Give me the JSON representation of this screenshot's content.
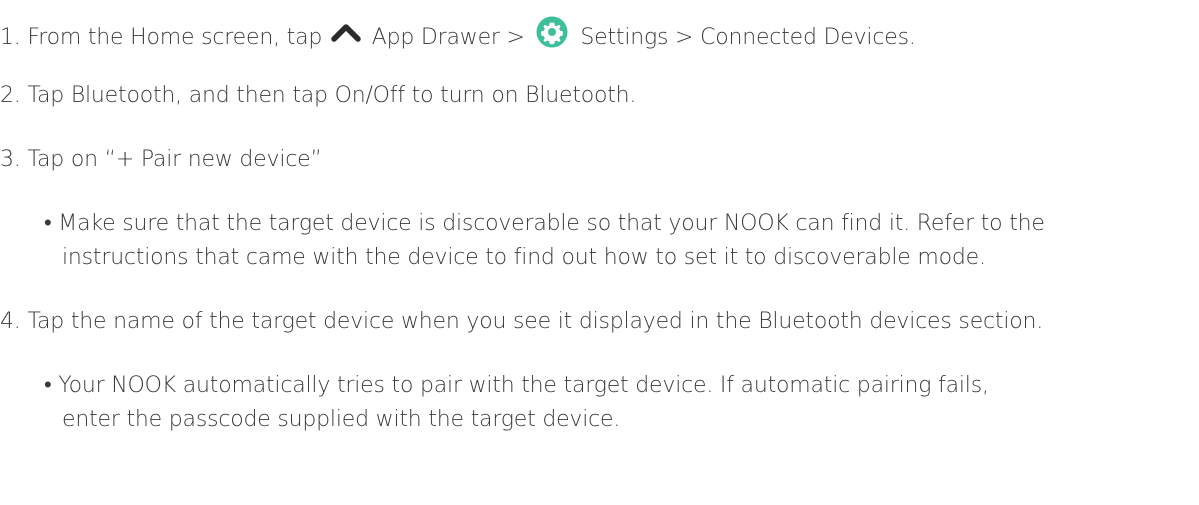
{
  "steps": {
    "step1": {
      "prefix": "1. From the Home screen, tap",
      "app_drawer": "App Drawer >",
      "settings": "Settings > Connected Devices.",
      "icons": [
        "chevron-up-icon",
        "gear-icon"
      ],
      "gear_color": "#3cbf9a"
    },
    "step2": "2. Tap Bluetooth, and then tap On/Off to turn on Bluetooth.",
    "step3": "3. Tap on “+ Pair new device”",
    "bullet1_line1": "• Make sure that the target device is discoverable so that your NOOK can find it. Refer to the",
    "bullet1_line2": "instructions that came with the device to find out how to set it to discoverable mode.",
    "step4": "4. Tap the name of the target device when you see it displayed in the Bluetooth devices section.",
    "bullet2_line1": "• Your NOOK automatically tries to pair with the target device. If automatic pairing fails,",
    "bullet2_line2": "enter the passcode supplied with the target device."
  }
}
